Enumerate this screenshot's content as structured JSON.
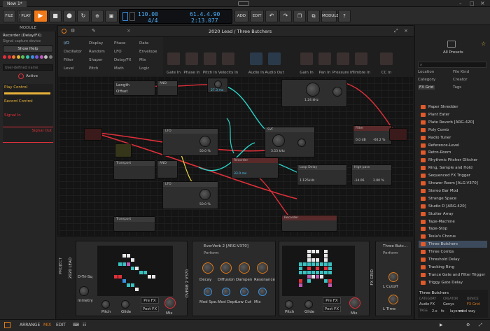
{
  "window": {
    "tab": "New 1*"
  },
  "toolbar": {
    "file": "FILE",
    "play": "PLAY",
    "add": "ADD",
    "edit": "EDIT",
    "module": "MODULE",
    "tempo": "110.00",
    "signature": "4/4",
    "position": "61.4.4.90",
    "time": "2:13.077"
  },
  "left": {
    "header": "MODULE",
    "device": "Recorder (Delay/FX)",
    "device_sub": "Signal capture device",
    "help": "Show Help",
    "user_label": "User-defined name",
    "active": "Active",
    "play_control": "Play Control",
    "record_control": "Record Control",
    "signal_in": "Signal In",
    "signal_out": "Signal Out",
    "dot_colors": [
      "#e0303a",
      "#e0303a",
      "#f07a2a",
      "#e8b23a",
      "#5ac05a",
      "#3ac0b0",
      "#3a8fe0",
      "#7a5ae0",
      "#c05ac0",
      "#c0c0c0",
      "#7a7a7a"
    ]
  },
  "editor": {
    "title": "2020 Lead / Three Butchers",
    "categories": [
      [
        "I/O",
        "Display",
        "Phase",
        "Data"
      ],
      [
        "Oscillator",
        "Random",
        "LFO",
        "Envelope"
      ],
      [
        "Filter",
        "Shaper",
        "Delay/FX",
        "Mix"
      ],
      [
        "Level",
        "Pitch",
        "Math",
        "Logic"
      ]
    ],
    "io": [
      "Gate In",
      "Phase In",
      "Pitch In",
      "Velocity In",
      "Audio In",
      "Audio Out",
      "Gain In",
      "Pan In",
      "Pressure In",
      "Timbre In",
      "CC In"
    ],
    "modules": {
      "transport": "Transport",
      "and": "AND",
      "lfo": "LFO",
      "svf": "SVF",
      "filter": "Filter",
      "recorder": "Recorder",
      "loop_delay": "Loop Delay",
      "high_pass": "High pass",
      "length": "Length",
      "offset": "Offset",
      "freq1": "1.24 kHz",
      "freq2": "3.53 kHz",
      "rate": "50.0 %",
      "rate2": "50.0 %",
      "val1": "27.3 ms",
      "val2": "33.0 ms",
      "val3": "0.0 dB",
      "val4": "-60.2 %",
      "val5": "2.00 %",
      "val6": "1.125kHz",
      "val7": "-14.06"
    },
    "accent": "#e0303a",
    "cable_cyan": "#2ad4c8",
    "cable_yellow": "#e8d43a"
  },
  "devices": {
    "tri_sq": "D-Tri-Sq",
    "symmetry": "mmetry",
    "d1": {
      "pitch": "Pitch",
      "glide": "Glide",
      "prefx": "Pre FX",
      "postfx": "Post FX",
      "mix": "Mix"
    },
    "verb": {
      "title": "EverVerb 2 [ARG-V370]",
      "perform": "Perform",
      "knobs": [
        "Decay",
        "Diffusion",
        "Dampen",
        "Resonance"
      ],
      "knobs2": [
        "Mod Spe...",
        "Mod Dept",
        "Low Cut",
        "Mix"
      ],
      "side": "OVERB 2 V370"
    },
    "d2": {
      "pitch": "Pitch",
      "glide": "Glide",
      "prefx": "Pre FX",
      "postfx": "Post FX",
      "mix": "Mix"
    },
    "tb": {
      "title": "Three Butc...",
      "perform": "Perform",
      "cutoff": "L Cutoff",
      "time": "L Time",
      "side": "FX GRID"
    },
    "project": "PROJECT",
    "lead": "2020 LEAD"
  },
  "browser": {
    "all_presets": "All Presets",
    "search_placeholder": "",
    "filters": [
      "Location",
      "File Kind",
      "Category",
      "Creator",
      "FX Grid",
      "Tags"
    ],
    "items": [
      "Paper Shredder",
      "Plant Eater",
      "Plate Reverb [ARG-420]",
      "Poly Comb",
      "Radio Tuner",
      "Reference-Level",
      "Retro-Room",
      "Rhythmic Pitcher Glitcher",
      "Ring, Sample and Hold",
      "Sequenced FX Trigger",
      "Shower Room [ALG-V370]",
      "Stereo Bar Mod",
      "Strange Space",
      "Studio D [ARG-420]",
      "Stutter Array",
      "Tape-Machine",
      "Tape-Stop",
      "Tesla's Chorus",
      "Three Butchers",
      "Three Combs",
      "Threshold Delay",
      "Tracking Ring",
      "Trance Gate and Filter Trigger",
      "Triggy Gate Delay"
    ],
    "selected": "Three Butchers",
    "footer": {
      "name": "Three Butchers",
      "cols": [
        "CATEGORY",
        "CREATOR",
        "DEVICE"
      ],
      "vals": [
        "Audio FX",
        "Genys",
        "FX Grid"
      ],
      "tags_label": "TAGS",
      "tags": [
        "2.x",
        "fx",
        "layered",
        "mod",
        "way"
      ]
    }
  },
  "status": {
    "arrange": "ARRANGE",
    "mix": "MIX",
    "edit": "EDIT"
  }
}
